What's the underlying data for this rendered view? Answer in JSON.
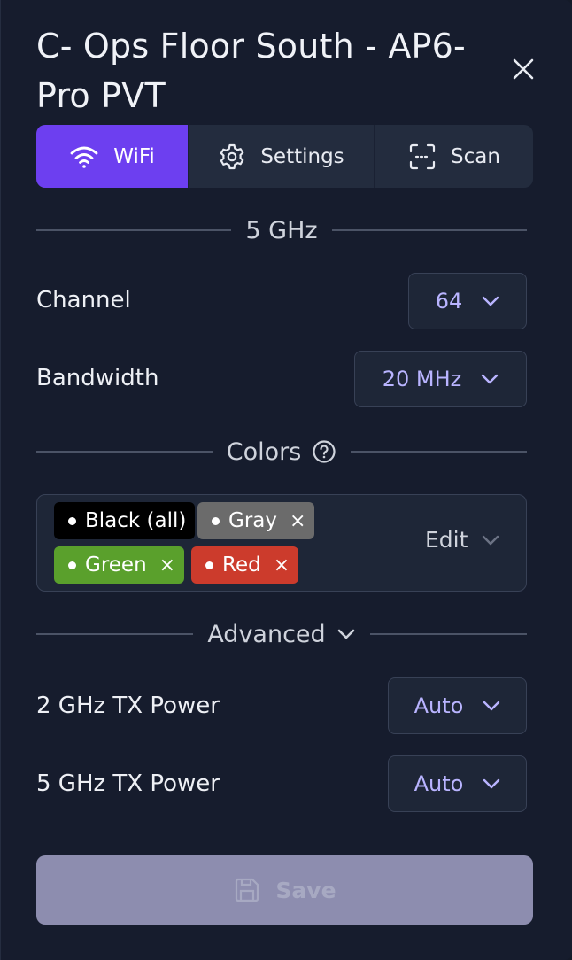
{
  "panel": {
    "title": "C- Ops Floor South - AP6-Pro PVT"
  },
  "tabs": [
    {
      "label": "WiFi",
      "icon": "wifi-icon",
      "active": true
    },
    {
      "label": "Settings",
      "icon": "gear-icon",
      "active": false
    },
    {
      "label": "Scan",
      "icon": "scan-icon",
      "active": false
    }
  ],
  "band_section": {
    "heading": "5 GHz",
    "channel": {
      "label": "Channel",
      "value": "64"
    },
    "bandwidth": {
      "label": "Bandwidth",
      "value": "20 MHz"
    }
  },
  "colors_section": {
    "heading": "Colors",
    "help_icon": "question-circle-icon",
    "chips": [
      {
        "label": "Black (all)",
        "color": "#000000",
        "removable": false
      },
      {
        "label": "Gray",
        "color": "#6b6b6b",
        "removable": true
      },
      {
        "label": "Green",
        "color": "#5aa02c",
        "removable": true
      },
      {
        "label": "Red",
        "color": "#cc3b2c",
        "removable": true
      }
    ],
    "remove_glyph": "×",
    "edit_label": "Edit"
  },
  "advanced_section": {
    "heading": "Advanced",
    "tx_2ghz": {
      "label": "2 GHz TX Power",
      "value": "Auto"
    },
    "tx_5ghz": {
      "label": "5 GHz TX Power",
      "value": "Auto"
    }
  },
  "footer": {
    "save_label": "Save",
    "save_enabled": false
  },
  "colors": {
    "accent": "#6d3ff0",
    "background": "#161c2d",
    "select_value": "#b9b4ff",
    "save_disabled": "#8d8daf"
  }
}
